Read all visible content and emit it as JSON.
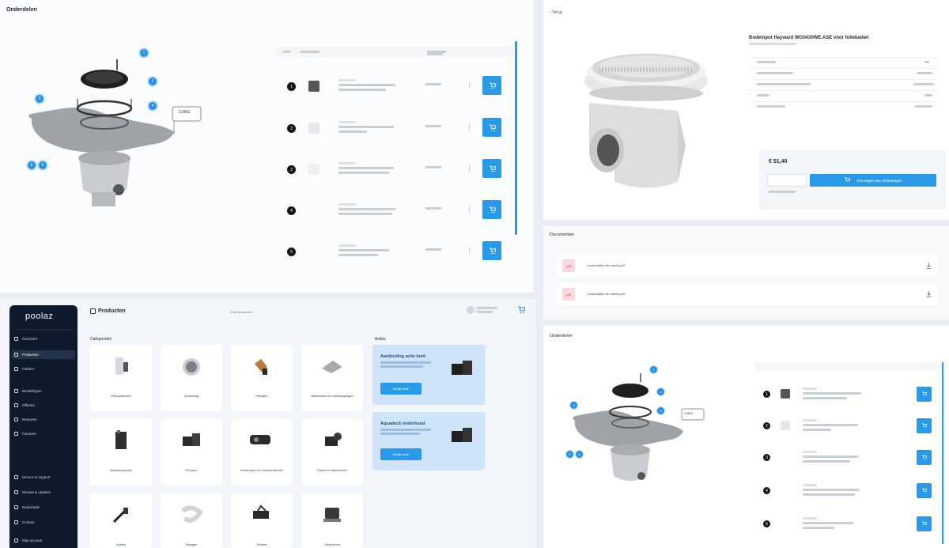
{
  "colors": {
    "accent": "#2a9ae6",
    "page_bg": "#e9eef4",
    "sidebar_bg": "#0f1a2c",
    "promo_bg": "#cfe3f9",
    "pdf_badge": "#f8d9dc"
  },
  "top_left": {
    "title": "Onderdelen",
    "diagram_label": "2,5KG",
    "callouts": [
      "1",
      "2",
      "3",
      "4",
      "5",
      "6"
    ],
    "table": {
      "rows": [
        {
          "num": "1",
          "add_icon": "cart-icon"
        },
        {
          "num": "2",
          "add_icon": "cart-icon"
        },
        {
          "num": "3",
          "add_icon": "cart-icon"
        },
        {
          "num": "4",
          "add_icon": "cart-icon"
        },
        {
          "num": "5",
          "add_icon": "cart-icon"
        }
      ]
    }
  },
  "top_right": {
    "breadcrumb_back": "‹ Terug",
    "product_title": "Bodemput Hayward WG0430WE.ASE voor foliebaden",
    "price": "€ 51,40",
    "add_to_cart": "Toevoegen aan winkelwagen",
    "documents_title": "Documenten",
    "documents": [
      {
        "badge": "pdf",
        "name": "(unreadable file name).pdf"
      },
      {
        "badge": "pdf",
        "name": "(unreadable file name).pdf"
      }
    ],
    "parts_title": "Onderdelen",
    "diagram_label": "2,5KG",
    "callouts": [
      "1",
      "2",
      "3",
      "4",
      "5",
      "6"
    ],
    "parts_rows": [
      {
        "num": "1"
      },
      {
        "num": "2"
      },
      {
        "num": "3"
      },
      {
        "num": "4"
      },
      {
        "num": "5"
      }
    ]
  },
  "app": {
    "logo": "poolaz",
    "sidebar": {
      "items": [
        {
          "label": "Overzicht",
          "icon": "home-icon"
        },
        {
          "label": "Producten",
          "icon": "box-icon",
          "active": true
        },
        {
          "label": "Folders",
          "icon": "folder-icon"
        },
        {
          "label": "Bestellingen",
          "icon": "order-icon"
        },
        {
          "label": "Offertes",
          "icon": "quote-icon"
        },
        {
          "label": "Retouren",
          "icon": "return-icon"
        },
        {
          "label": "Facturen",
          "icon": "invoice-icon"
        }
      ],
      "bottom_items": [
        {
          "label": "Service & support",
          "icon": "support-icon"
        },
        {
          "label": "Nieuws & updates",
          "icon": "news-icon"
        },
        {
          "label": "Downloads",
          "icon": "download-icon"
        },
        {
          "label": "Contact",
          "icon": "contact-icon"
        },
        {
          "label": "Mijn account",
          "icon": "user-icon"
        }
      ]
    },
    "header": {
      "title": "Producten",
      "search_placeholder": "Zoek producten...",
      "account_line1": "",
      "account_line2": ""
    },
    "categories_title": "Categorieën",
    "categories": [
      {
        "label": "Filtersystemen",
        "icon": "filter-icon"
      },
      {
        "label": "Verlichting",
        "icon": "light-icon"
      },
      {
        "label": "Fittingen",
        "icon": "fitting-icon"
      },
      {
        "label": "Afdekzeilen en overkappingen",
        "icon": "cover-icon"
      },
      {
        "label": "Warmtepompen",
        "icon": "heatpump-icon"
      },
      {
        "label": "Pompen",
        "icon": "pump-icon"
      },
      {
        "label": "Elektrolyse en chloorproductie",
        "icon": "electrolysis-icon"
      },
      {
        "label": "Filters en toebehoren",
        "icon": "accessory-icon"
      },
      {
        "label": "Kabels",
        "icon": "cable-icon"
      },
      {
        "label": "Slangen",
        "icon": "hose-icon"
      },
      {
        "label": "Robots",
        "icon": "robot-icon"
      },
      {
        "label": "Onderhoud",
        "icon": "maintenance-icon"
      }
    ],
    "promo_title": "Acties",
    "promos": [
      {
        "title": "Aanbieding actie beid",
        "button": "Bekijk actie"
      },
      {
        "title": "Aquadeck onderhoud",
        "button": "Bekijk actie"
      }
    ]
  }
}
